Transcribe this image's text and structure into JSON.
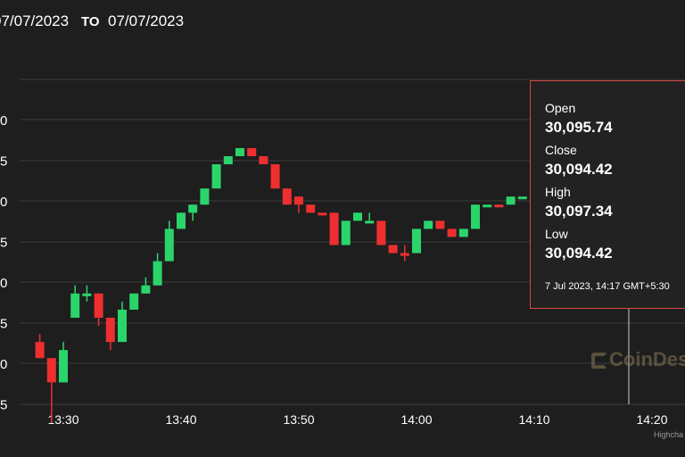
{
  "header": {
    "from_date": "07/07/2023",
    "to_label": "TO",
    "to_date": "07/07/2023"
  },
  "tooltip": {
    "open_label": "Open",
    "open_value": "30,095.74",
    "close_label": "Close",
    "close_value": "30,094.42",
    "high_label": "High",
    "high_value": "30,097.34",
    "low_label": "Low",
    "low_value": "30,094.42",
    "date_text": "7 Jul 2023, 14:17 GMT+5:30"
  },
  "watermark": "CoinDes",
  "credits": "Highcha",
  "colors": {
    "up": "#2bd46b",
    "down": "#ee2f2f",
    "grid": "#3c3c3c",
    "crosshair": "#cfcfcf",
    "tooltip_border": "#d8483c"
  },
  "chart_data": {
    "type": "candlestick",
    "x_ticks": [
      "13:30",
      "13:40",
      "13:50",
      "14:00",
      "14:10",
      "14:20"
    ],
    "y_ticks": [
      "0",
      "5",
      "0",
      "5",
      "0",
      "5",
      "0",
      "5"
    ],
    "candles": [
      {
        "time": "13:28",
        "open": 30065,
        "high": 30066,
        "low": 30063,
        "close": 30063,
        "dir": "down"
      },
      {
        "time": "13:29",
        "open": 30063,
        "high": 30063,
        "low": 30055,
        "close": 30060,
        "dir": "down"
      },
      {
        "time": "13:30",
        "open": 30060,
        "high": 30065,
        "low": 30060,
        "close": 30064,
        "dir": "up"
      },
      {
        "time": "13:31",
        "open": 30068,
        "high": 30072,
        "low": 30068,
        "close": 30071,
        "dir": "up"
      },
      {
        "time": "13:32",
        "open": 30071,
        "high": 30072,
        "low": 30070,
        "close": 30071,
        "dir": "up"
      },
      {
        "time": "13:33",
        "open": 30071,
        "high": 30071,
        "low": 30067,
        "close": 30068,
        "dir": "down"
      },
      {
        "time": "13:34",
        "open": 30068,
        "high": 30068,
        "low": 30064,
        "close": 30065,
        "dir": "down"
      },
      {
        "time": "13:35",
        "open": 30065,
        "high": 30070,
        "low": 30065,
        "close": 30069,
        "dir": "up"
      },
      {
        "time": "13:36",
        "open": 30069,
        "high": 30071,
        "low": 30069,
        "close": 30071,
        "dir": "up"
      },
      {
        "time": "13:37",
        "open": 30071,
        "high": 30073,
        "low": 30071,
        "close": 30072,
        "dir": "up"
      },
      {
        "time": "13:38",
        "open": 30072,
        "high": 30076,
        "low": 30072,
        "close": 30075,
        "dir": "up"
      },
      {
        "time": "13:39",
        "open": 30075,
        "high": 30080,
        "low": 30075,
        "close": 30079,
        "dir": "up"
      },
      {
        "time": "13:40",
        "open": 30079,
        "high": 30081,
        "low": 30079,
        "close": 30081,
        "dir": "up"
      },
      {
        "time": "13:41",
        "open": 30081,
        "high": 30082,
        "low": 30080,
        "close": 30082,
        "dir": "up"
      },
      {
        "time": "13:42",
        "open": 30082,
        "high": 30084,
        "low": 30082,
        "close": 30084,
        "dir": "up"
      },
      {
        "time": "13:43",
        "open": 30084,
        "high": 30087,
        "low": 30084,
        "close": 30087,
        "dir": "up"
      },
      {
        "time": "13:44",
        "open": 30087,
        "high": 30088,
        "low": 30087,
        "close": 30088,
        "dir": "up"
      },
      {
        "time": "13:45",
        "open": 30088,
        "high": 30089,
        "low": 30088,
        "close": 30089,
        "dir": "up"
      },
      {
        "time": "13:46",
        "open": 30089,
        "high": 30089,
        "low": 30088,
        "close": 30088,
        "dir": "down"
      },
      {
        "time": "13:47",
        "open": 30088,
        "high": 30088,
        "low": 30087,
        "close": 30087,
        "dir": "down"
      },
      {
        "time": "13:48",
        "open": 30087,
        "high": 30087,
        "low": 30084,
        "close": 30084,
        "dir": "down"
      },
      {
        "time": "13:49",
        "open": 30084,
        "high": 30084,
        "low": 30082,
        "close": 30082,
        "dir": "down"
      },
      {
        "time": "13:50",
        "open": 30083,
        "high": 30083,
        "low": 30081,
        "close": 30082,
        "dir": "down"
      },
      {
        "time": "13:51",
        "open": 30082,
        "high": 30082,
        "low": 30081,
        "close": 30081,
        "dir": "down"
      },
      {
        "time": "13:52",
        "open": 30081,
        "high": 30081,
        "low": 30081,
        "close": 30081,
        "dir": "down"
      },
      {
        "time": "13:53",
        "open": 30081,
        "high": 30081,
        "low": 30077,
        "close": 30077,
        "dir": "down"
      },
      {
        "time": "13:54",
        "open": 30077,
        "high": 30080,
        "low": 30077,
        "close": 30080,
        "dir": "up"
      },
      {
        "time": "13:55",
        "open": 30080,
        "high": 30081,
        "low": 30080,
        "close": 30081,
        "dir": "up"
      },
      {
        "time": "13:56",
        "open": 30080,
        "high": 30081,
        "low": 30080,
        "close": 30080,
        "dir": "up"
      },
      {
        "time": "13:57",
        "open": 30080,
        "high": 30080,
        "low": 30077,
        "close": 30077,
        "dir": "down"
      },
      {
        "time": "13:58",
        "open": 30077,
        "high": 30077,
        "low": 30076,
        "close": 30076,
        "dir": "down"
      },
      {
        "time": "13:59",
        "open": 30076,
        "high": 30077,
        "low": 30075,
        "close": 30076,
        "dir": "down"
      },
      {
        "time": "14:00",
        "open": 30076,
        "high": 30079,
        "low": 30076,
        "close": 30079,
        "dir": "up"
      },
      {
        "time": "14:01",
        "open": 30079,
        "high": 30080,
        "low": 30079,
        "close": 30080,
        "dir": "up"
      },
      {
        "time": "14:02",
        "open": 30080,
        "high": 30080,
        "low": 30079,
        "close": 30079,
        "dir": "down"
      },
      {
        "time": "14:03",
        "open": 30079,
        "high": 30079,
        "low": 30078,
        "close": 30078,
        "dir": "down"
      },
      {
        "time": "14:04",
        "open": 30078,
        "high": 30079,
        "low": 30078,
        "close": 30079,
        "dir": "up"
      },
      {
        "time": "14:05",
        "open": 30079,
        "high": 30082,
        "low": 30079,
        "close": 30082,
        "dir": "up"
      },
      {
        "time": "14:06",
        "open": 30082,
        "high": 30082,
        "low": 30082,
        "close": 30082,
        "dir": "up"
      },
      {
        "time": "14:07",
        "open": 30082,
        "high": 30082,
        "low": 30082,
        "close": 30082,
        "dir": "down"
      },
      {
        "time": "14:08",
        "open": 30082,
        "high": 30083,
        "low": 30082,
        "close": 30083,
        "dir": "up"
      },
      {
        "time": "14:09",
        "open": 30083,
        "high": 30083,
        "low": 30083,
        "close": 30083,
        "dir": "up"
      },
      {
        "time": "14:10",
        "open": 30083,
        "high": 30085,
        "low": 30083,
        "close": 30085,
        "dir": "up"
      }
    ]
  }
}
